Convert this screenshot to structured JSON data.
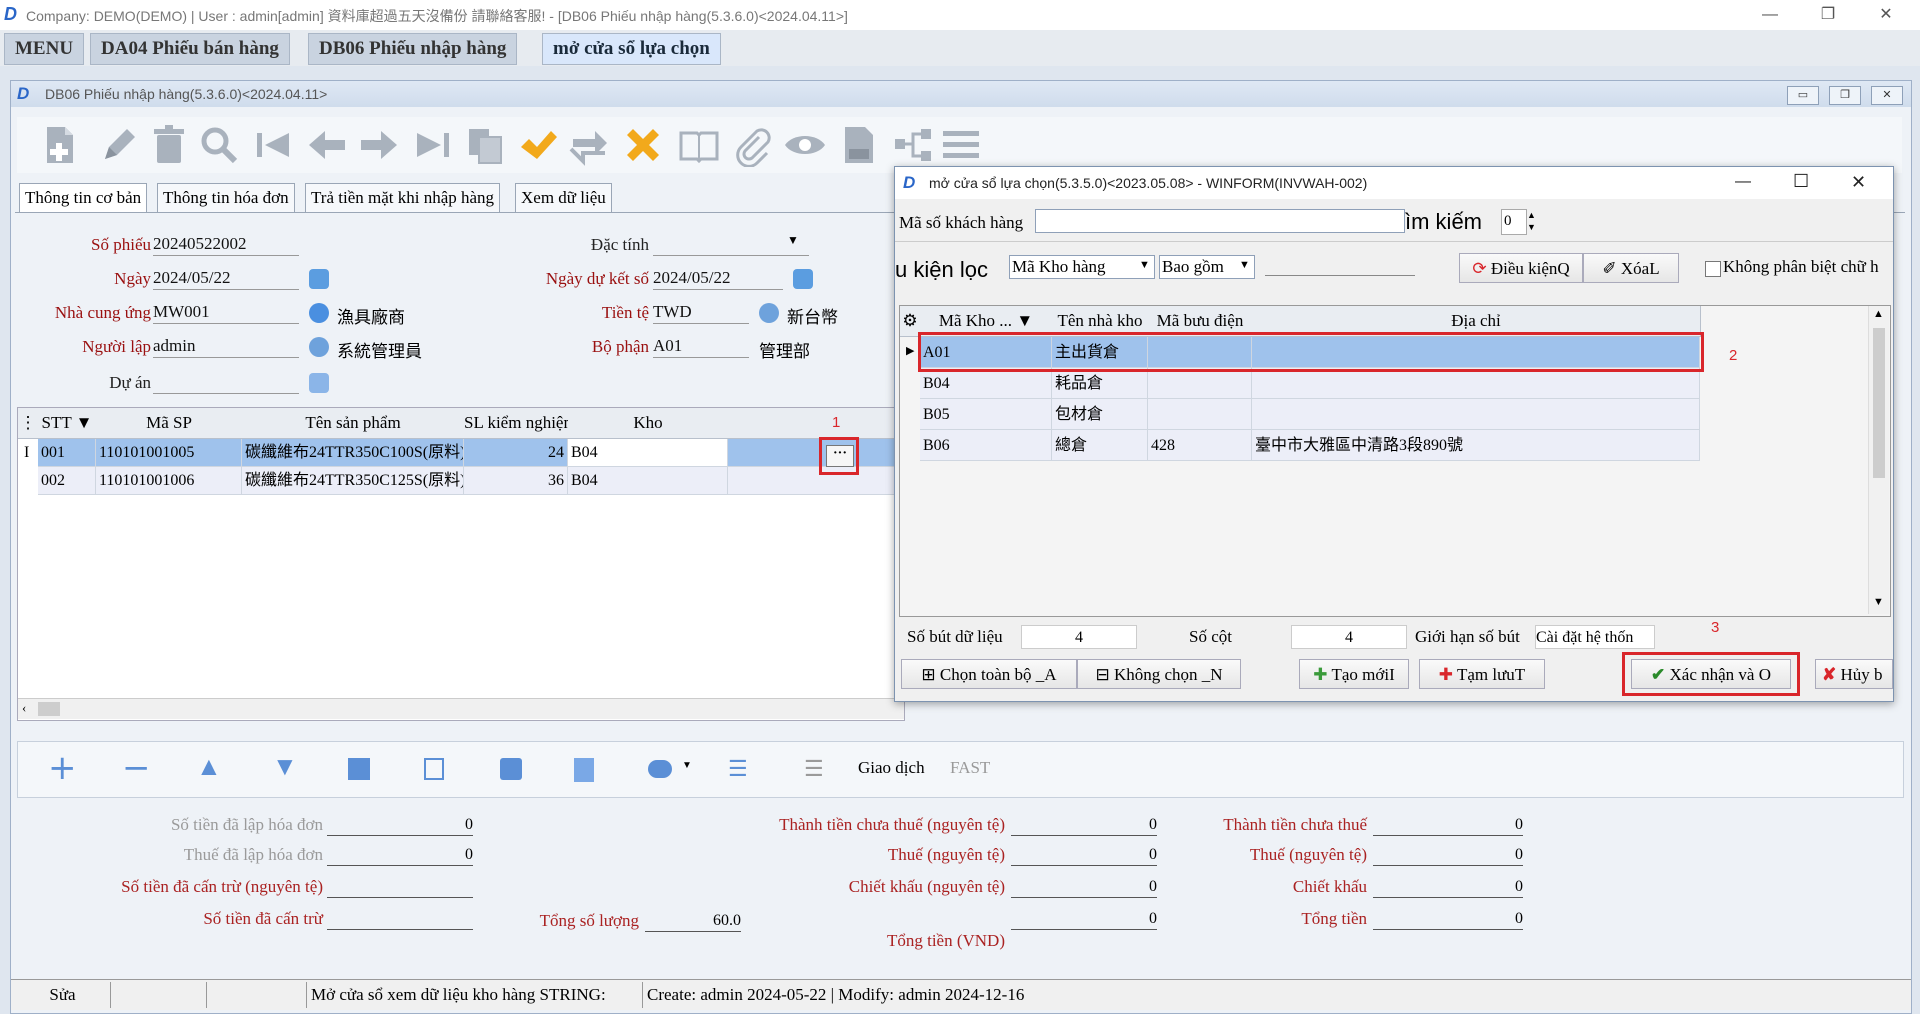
{
  "window": {
    "title": "Company: DEMO(DEMO) | User : admin[admin] 資料庫超過五天沒備份 請聯絡客服! - [DB06 Phiếu nhập hàng(5.3.6.0)<2024.04.11>]",
    "min": "—",
    "restore": "❐",
    "close": "✕"
  },
  "tabs": [
    "MENU",
    "DA04 Phiếu bán hàng",
    "DB06 Phiếu nhập hàng",
    "mở cửa sổ lựa chọn"
  ],
  "inner": {
    "title": "DB06 Phiếu nhập hàng(5.3.6.0)<2024.04.11>",
    "min": "▭",
    "restore": "❐",
    "close": "✕"
  },
  "subtabs": [
    "Thông tin cơ bản",
    "Thông tin hóa đơn",
    "Trả tiền mặt khi nhập hàng",
    "Xem dữ liệu"
  ],
  "form": {
    "so_phieu_label": "Số phiếu",
    "so_phieu": "20240522002",
    "ngay_label": "Ngày",
    "ngay": "2024/05/22",
    "ncc_label": "Nhà cung ứng",
    "ncc": "MW001",
    "ncc_name": "漁具廠商",
    "nguoi_lap_label": "Người lập",
    "nguoi_lap": "admin",
    "nguoi_lap_name": "系統管理員",
    "du_an_label": "Dự án",
    "dac_tinh_label": "Đặc tính",
    "ngay_du_ket_label": "Ngày dự kết số",
    "ngay_du_ket": "2024/05/22",
    "tien_te_label": "Tiền tệ",
    "tien_te": "TWD",
    "tien_te_name": "新台幣",
    "bo_phan_label": "Bộ phận",
    "bo_phan": "A01",
    "bo_phan_name": "管理部"
  },
  "grid": {
    "headers": [
      "STT",
      "Mã SP",
      "Tên sản phẩm",
      "SL kiểm nghiệm",
      "Kho"
    ],
    "rows": [
      {
        "stt": "001",
        "ma": "110101001005",
        "ten": "碳纖維布24TTR350C100S(原料)",
        "sl": "24",
        "kho": "B04"
      },
      {
        "stt": "002",
        "ma": "110101001006",
        "ten": "碳纖維布24TTR350C125S(原料)",
        "sl": "36",
        "kho": "B04"
      }
    ],
    "row_marker": "I",
    "ellipsis": "···"
  },
  "markers": {
    "m1": "1",
    "m2": "2",
    "m3": "3"
  },
  "bottom_toolbar": {
    "giao_dich": "Giao dịch",
    "fast": "FAST"
  },
  "totals": {
    "left": [
      {
        "label": "Số tiền đã lập hóa đơn",
        "value": "0"
      },
      {
        "label": "Thuế đã lập hóa đơn",
        "value": "0"
      },
      {
        "label": "Số tiền đã cấn trừ (nguyên tệ)",
        "value": ""
      },
      {
        "label": "Số tiền đã cấn trừ",
        "value": ""
      }
    ],
    "mid": [
      {
        "label": "Thành tiền chưa thuế (nguyên tệ)",
        "value": "0"
      },
      {
        "label": "Thuế (nguyên tệ)",
        "value": "0"
      },
      {
        "label": "Chiết khấu (nguyên tệ)",
        "value": "0"
      },
      {
        "label": "Tổng tiền (VND)",
        "value": "0"
      }
    ],
    "right": [
      {
        "label": "Thành tiền chưa thuế",
        "value": "0"
      },
      {
        "label": "Thuế (nguyên tệ)",
        "value": "0"
      },
      {
        "label": "Chiết khấu",
        "value": "0"
      },
      {
        "label": "Tổng tiền",
        "value": "0"
      }
    ],
    "tong_so_luong_label": "Tổng số lượng",
    "tong_so_luong": "60.0"
  },
  "status": {
    "mode": "Sửa",
    "msg": "Mở cửa sổ xem dữ liệu kho hàng STRING:",
    "audit": "Create: admin 2024-05-22 | Modify: admin 2024-12-16"
  },
  "dialog": {
    "title": "mở cửa sổ lựa chọn(5.3.5.0)<2023.05.08> - WINFORM(INVWAH-002)",
    "min": "—",
    "max": "☐",
    "close": "✕",
    "ma_kh_label": "Mã số khách hàng",
    "tim_kiem_label": "ìm kiếm",
    "tim_kiem_value": "0",
    "filter_label": "u kiện lọc",
    "filter_field": "Mã Kho hàng",
    "filter_op": "Bao gồm",
    "dieu_kien_btn": "Điều kiệnQ",
    "xoa_btn": "XóaL",
    "khong_phan_biet": "Không phân biệt chữ h",
    "headers": [
      "Mã Kho ...",
      "Tên nhà kho",
      "Mã bưu điện",
      "Địa chỉ"
    ],
    "rows": [
      {
        "ma": "A01",
        "ten": "主出貨倉",
        "buu": "",
        "dia": ""
      },
      {
        "ma": "B04",
        "ten": "耗品倉",
        "buu": "",
        "dia": ""
      },
      {
        "ma": "B05",
        "ten": "包材倉",
        "buu": "",
        "dia": ""
      },
      {
        "ma": "B06",
        "ten": "總倉",
        "buu": "428",
        "dia": "臺中市大雅區中清路3段890號"
      }
    ],
    "so_but_label": "Số bút dữ liệu",
    "so_but": "4",
    "so_cot_label": "Số cột",
    "so_cot": "4",
    "gioi_han_label": "Giới hạn số bút",
    "gioi_han": "Cài đặt hệ thốn",
    "chon_toan_bo": "Chọn toàn bộ _A",
    "khong_chon": "Không chọn _N",
    "tao_moi": "Tạo mớiI",
    "tam_luu": "Tạm lưuT",
    "xac_nhan": "Xác nhận và O",
    "huy": "Hủy b"
  }
}
